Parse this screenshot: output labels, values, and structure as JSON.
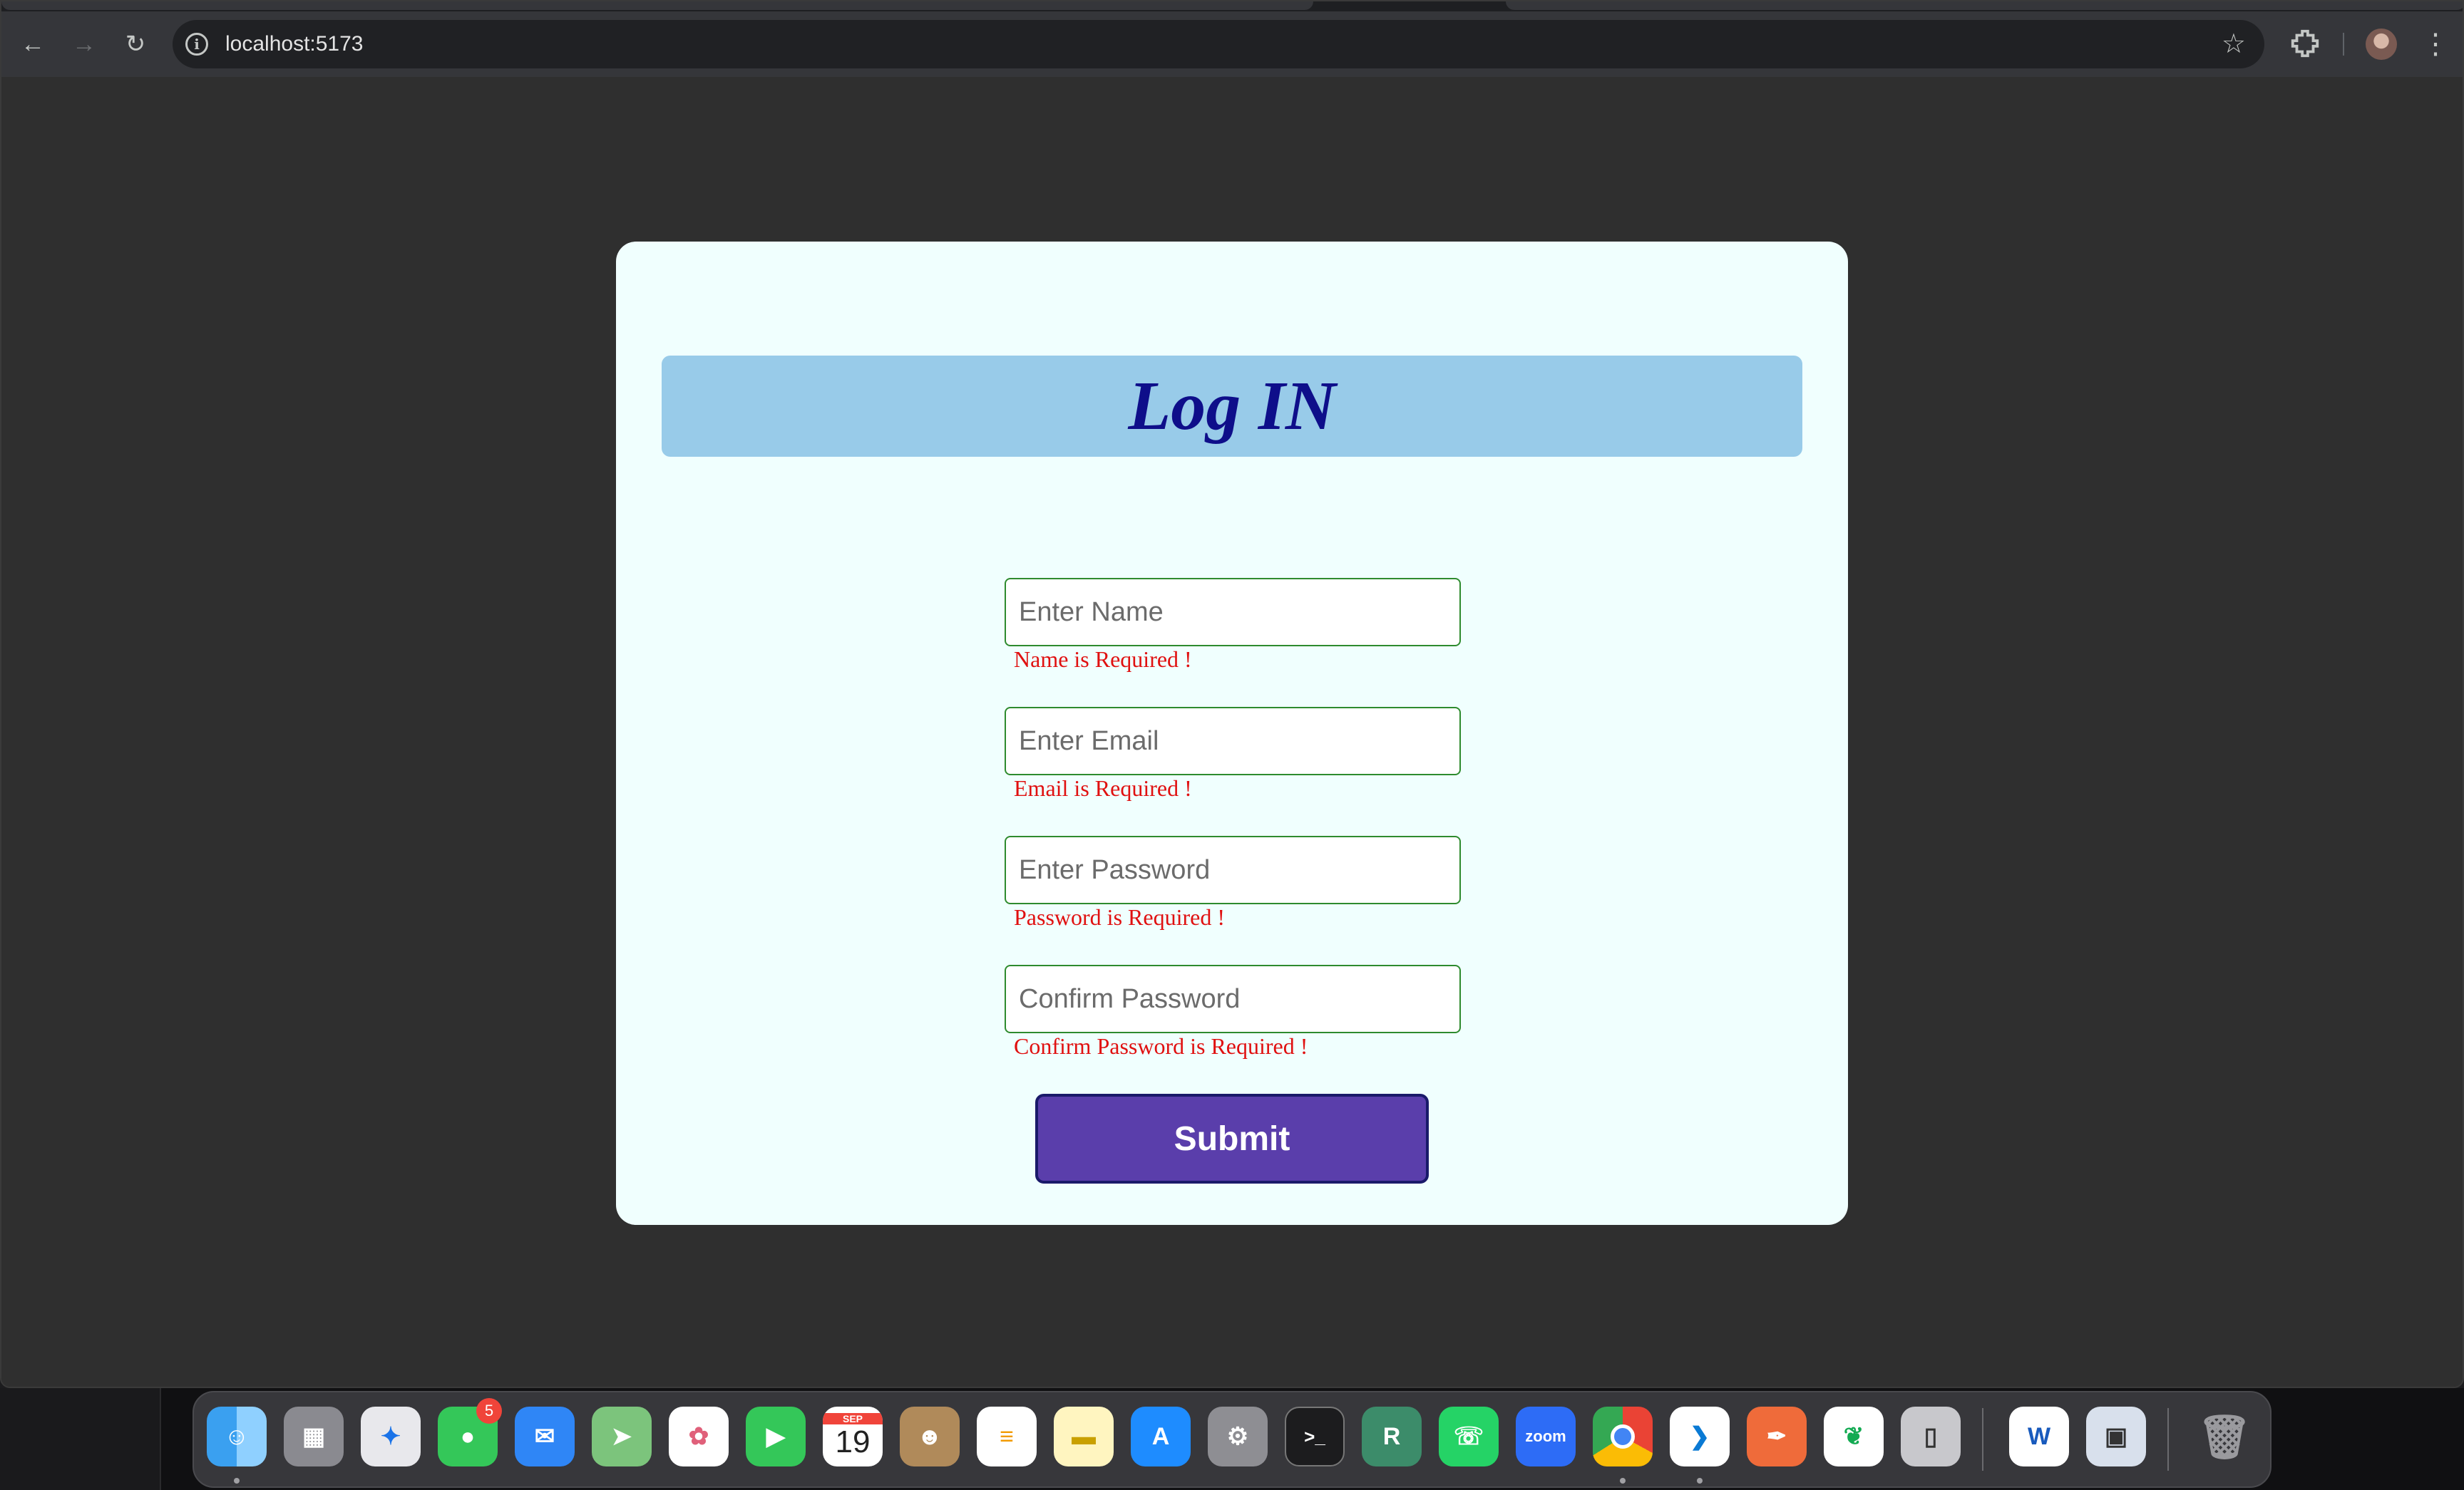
{
  "browser": {
    "url": "localhost:5173",
    "icons": [
      "back-icon",
      "forward-icon",
      "reload-icon",
      "site-info-icon",
      "bookmark-star-icon",
      "extensions-icon",
      "profile-avatar",
      "menu-icon"
    ]
  },
  "form": {
    "title": "Log IN",
    "fields": [
      {
        "placeholder": "Enter Name",
        "error": "Name is Required !"
      },
      {
        "placeholder": "Enter Email",
        "error": "Email is Required !"
      },
      {
        "placeholder": "Enter Password",
        "error": "Password is Required !"
      },
      {
        "placeholder": "Confirm Password",
        "error": "Confirm Password is Required !"
      }
    ],
    "submit_label": "Submit"
  },
  "dock": {
    "messages_badge": "5",
    "calendar_month": "SEP",
    "calendar_day": "19",
    "zoom_label": "zoom",
    "word_label": "W",
    "rstudio_label": "R"
  },
  "colors": {
    "page_bg": "#2f2f2f",
    "card_bg": "#f0fffe",
    "header_bg": "#98cbe9",
    "title_color": "#0e0e8a",
    "error_color": "#e01010",
    "submit_bg": "#5a3eab",
    "field_border": "#2e8b2e"
  }
}
